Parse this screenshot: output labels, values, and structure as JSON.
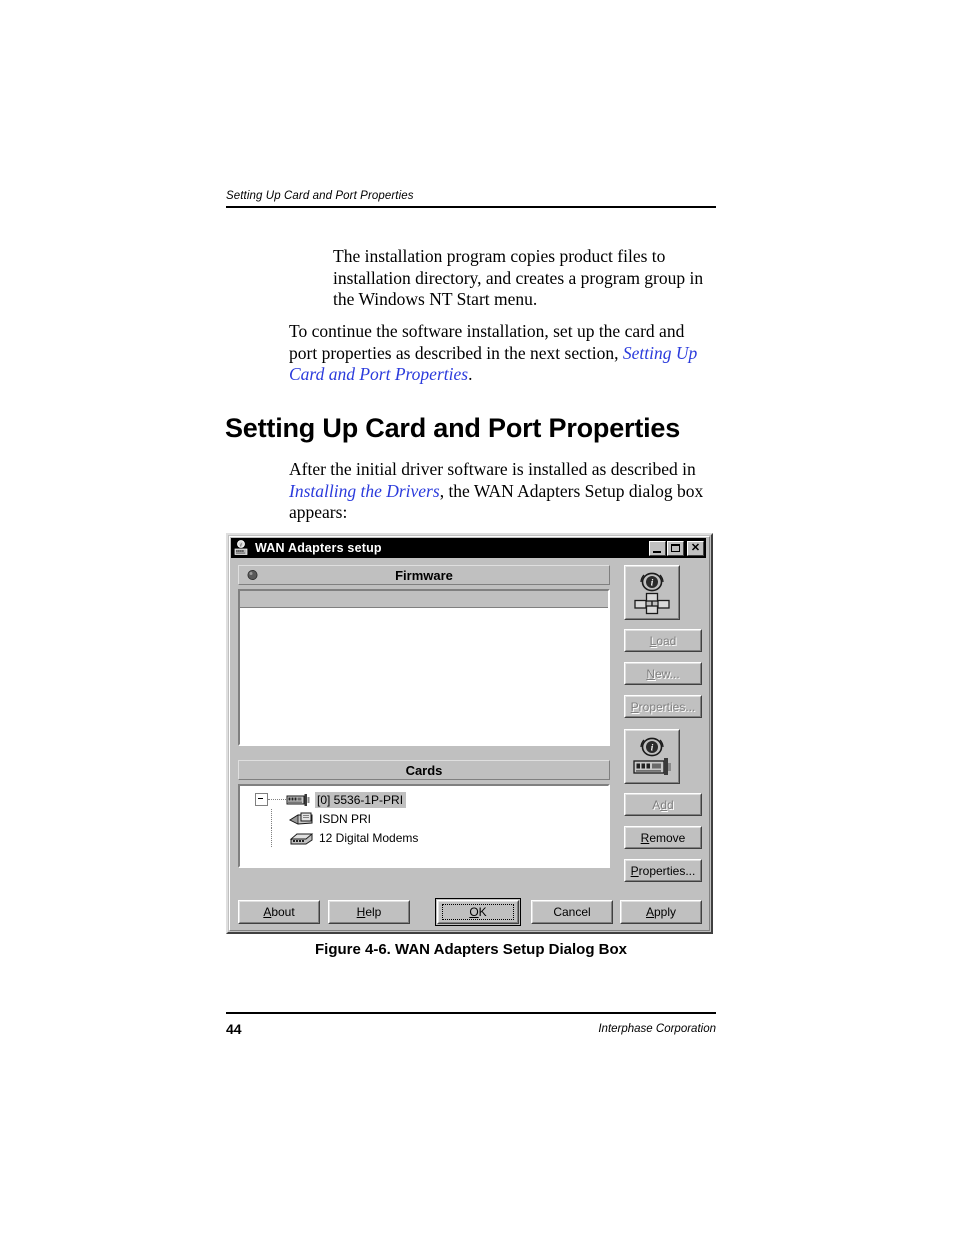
{
  "document": {
    "running_header": "Setting Up Card and Port Properties",
    "section_heading": "Setting Up Card and Port Properties",
    "paragraph_1": "The installation program copies product files to installation directory, and creates a program group in the Windows NT Start menu.",
    "paragraph_2": {
      "part_1": "To continue the software installation, set up the card and port properties as described in the next section, ",
      "xref": "Setting Up Card and Port Properties",
      "part_2": "."
    },
    "paragraph_3": {
      "part_1": "After the initial driver software is installed as described in ",
      "xref": "Installing the Drivers",
      "part_2": ", the WAN Adapters Setup dialog box appears:"
    },
    "figure_caption": "Figure 4-6.  WAN Adapters Setup Dialog Box",
    "footer": {
      "page_number": "44",
      "company": "Interphase Corporation"
    }
  },
  "dialog": {
    "title": "WAN Adapters setup",
    "titlebar_icon": "network-card-icon",
    "window_controls": [
      {
        "name": "minimize-button",
        "glyph": "minimize"
      },
      {
        "name": "maximize-button",
        "glyph": "maximize"
      },
      {
        "name": "close-button",
        "glyph": "✕"
      }
    ],
    "firmware_section": {
      "header_label": "Firmware",
      "header_icon": "sphere-icon",
      "list_items": [],
      "info_button_icon": "firmware-network-info-icon",
      "buttons": [
        {
          "label": "Load",
          "mnemonic": "L",
          "enabled": false,
          "name": "load-button"
        },
        {
          "label": "New...",
          "mnemonic": "N",
          "enabled": false,
          "name": "new-button"
        },
        {
          "label": "Properties...",
          "mnemonic": "P",
          "enabled": false,
          "name": "firmware-properties-button"
        }
      ]
    },
    "cards_section": {
      "header_label": "Cards",
      "info_button_icon": "card-info-icon",
      "tree": [
        {
          "label": "[0] 5536-1P-PRI",
          "icon": "adapter-card-icon",
          "selected": true,
          "expanded": true,
          "children": [
            {
              "label": "ISDN PRI",
              "icon": "isdn-port-icon"
            },
            {
              "label": "12 Digital Modems",
              "icon": "modem-icon"
            }
          ]
        }
      ],
      "buttons": [
        {
          "label": "Add",
          "mnemonic": "d",
          "enabled": false,
          "name": "add-button"
        },
        {
          "label": "Remove",
          "mnemonic": "R",
          "enabled": true,
          "name": "remove-button"
        },
        {
          "label": "Properties...",
          "mnemonic": "P",
          "enabled": true,
          "name": "cards-properties-button"
        }
      ]
    },
    "bottom_buttons": [
      {
        "label": "About",
        "mnemonic": "A",
        "name": "about-button",
        "default": false
      },
      {
        "label": "Help",
        "mnemonic": "H",
        "name": "help-button",
        "default": false
      },
      {
        "label": "OK",
        "mnemonic": "O",
        "name": "ok-button",
        "default": true
      },
      {
        "label": "Cancel",
        "mnemonic": "",
        "name": "cancel-button",
        "default": false
      },
      {
        "label": "Apply",
        "mnemonic": "A",
        "name": "apply-button",
        "default": false
      }
    ]
  },
  "colors": {
    "xref_link": "#2b3bdc",
    "dialog_face": "#c0c0c0",
    "titlebar": "#000000",
    "disabled_text": "#808080"
  }
}
